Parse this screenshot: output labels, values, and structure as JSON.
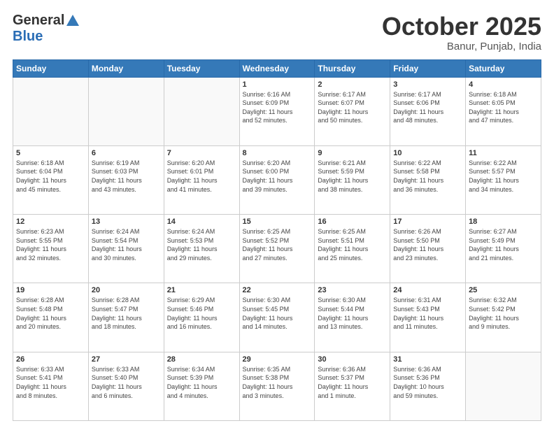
{
  "header": {
    "logo_general": "General",
    "logo_blue": "Blue",
    "month": "October 2025",
    "location": "Banur, Punjab, India"
  },
  "weekdays": [
    "Sunday",
    "Monday",
    "Tuesday",
    "Wednesday",
    "Thursday",
    "Friday",
    "Saturday"
  ],
  "weeks": [
    [
      {
        "day": "",
        "info": ""
      },
      {
        "day": "",
        "info": ""
      },
      {
        "day": "",
        "info": ""
      },
      {
        "day": "1",
        "info": "Sunrise: 6:16 AM\nSunset: 6:09 PM\nDaylight: 11 hours\nand 52 minutes."
      },
      {
        "day": "2",
        "info": "Sunrise: 6:17 AM\nSunset: 6:07 PM\nDaylight: 11 hours\nand 50 minutes."
      },
      {
        "day": "3",
        "info": "Sunrise: 6:17 AM\nSunset: 6:06 PM\nDaylight: 11 hours\nand 48 minutes."
      },
      {
        "day": "4",
        "info": "Sunrise: 6:18 AM\nSunset: 6:05 PM\nDaylight: 11 hours\nand 47 minutes."
      }
    ],
    [
      {
        "day": "5",
        "info": "Sunrise: 6:18 AM\nSunset: 6:04 PM\nDaylight: 11 hours\nand 45 minutes."
      },
      {
        "day": "6",
        "info": "Sunrise: 6:19 AM\nSunset: 6:03 PM\nDaylight: 11 hours\nand 43 minutes."
      },
      {
        "day": "7",
        "info": "Sunrise: 6:20 AM\nSunset: 6:01 PM\nDaylight: 11 hours\nand 41 minutes."
      },
      {
        "day": "8",
        "info": "Sunrise: 6:20 AM\nSunset: 6:00 PM\nDaylight: 11 hours\nand 39 minutes."
      },
      {
        "day": "9",
        "info": "Sunrise: 6:21 AM\nSunset: 5:59 PM\nDaylight: 11 hours\nand 38 minutes."
      },
      {
        "day": "10",
        "info": "Sunrise: 6:22 AM\nSunset: 5:58 PM\nDaylight: 11 hours\nand 36 minutes."
      },
      {
        "day": "11",
        "info": "Sunrise: 6:22 AM\nSunset: 5:57 PM\nDaylight: 11 hours\nand 34 minutes."
      }
    ],
    [
      {
        "day": "12",
        "info": "Sunrise: 6:23 AM\nSunset: 5:55 PM\nDaylight: 11 hours\nand 32 minutes."
      },
      {
        "day": "13",
        "info": "Sunrise: 6:24 AM\nSunset: 5:54 PM\nDaylight: 11 hours\nand 30 minutes."
      },
      {
        "day": "14",
        "info": "Sunrise: 6:24 AM\nSunset: 5:53 PM\nDaylight: 11 hours\nand 29 minutes."
      },
      {
        "day": "15",
        "info": "Sunrise: 6:25 AM\nSunset: 5:52 PM\nDaylight: 11 hours\nand 27 minutes."
      },
      {
        "day": "16",
        "info": "Sunrise: 6:25 AM\nSunset: 5:51 PM\nDaylight: 11 hours\nand 25 minutes."
      },
      {
        "day": "17",
        "info": "Sunrise: 6:26 AM\nSunset: 5:50 PM\nDaylight: 11 hours\nand 23 minutes."
      },
      {
        "day": "18",
        "info": "Sunrise: 6:27 AM\nSunset: 5:49 PM\nDaylight: 11 hours\nand 21 minutes."
      }
    ],
    [
      {
        "day": "19",
        "info": "Sunrise: 6:28 AM\nSunset: 5:48 PM\nDaylight: 11 hours\nand 20 minutes."
      },
      {
        "day": "20",
        "info": "Sunrise: 6:28 AM\nSunset: 5:47 PM\nDaylight: 11 hours\nand 18 minutes."
      },
      {
        "day": "21",
        "info": "Sunrise: 6:29 AM\nSunset: 5:46 PM\nDaylight: 11 hours\nand 16 minutes."
      },
      {
        "day": "22",
        "info": "Sunrise: 6:30 AM\nSunset: 5:45 PM\nDaylight: 11 hours\nand 14 minutes."
      },
      {
        "day": "23",
        "info": "Sunrise: 6:30 AM\nSunset: 5:44 PM\nDaylight: 11 hours\nand 13 minutes."
      },
      {
        "day": "24",
        "info": "Sunrise: 6:31 AM\nSunset: 5:43 PM\nDaylight: 11 hours\nand 11 minutes."
      },
      {
        "day": "25",
        "info": "Sunrise: 6:32 AM\nSunset: 5:42 PM\nDaylight: 11 hours\nand 9 minutes."
      }
    ],
    [
      {
        "day": "26",
        "info": "Sunrise: 6:33 AM\nSunset: 5:41 PM\nDaylight: 11 hours\nand 8 minutes."
      },
      {
        "day": "27",
        "info": "Sunrise: 6:33 AM\nSunset: 5:40 PM\nDaylight: 11 hours\nand 6 minutes."
      },
      {
        "day": "28",
        "info": "Sunrise: 6:34 AM\nSunset: 5:39 PM\nDaylight: 11 hours\nand 4 minutes."
      },
      {
        "day": "29",
        "info": "Sunrise: 6:35 AM\nSunset: 5:38 PM\nDaylight: 11 hours\nand 3 minutes."
      },
      {
        "day": "30",
        "info": "Sunrise: 6:36 AM\nSunset: 5:37 PM\nDaylight: 11 hours\nand 1 minute."
      },
      {
        "day": "31",
        "info": "Sunrise: 6:36 AM\nSunset: 5:36 PM\nDaylight: 10 hours\nand 59 minutes."
      },
      {
        "day": "",
        "info": ""
      }
    ]
  ]
}
